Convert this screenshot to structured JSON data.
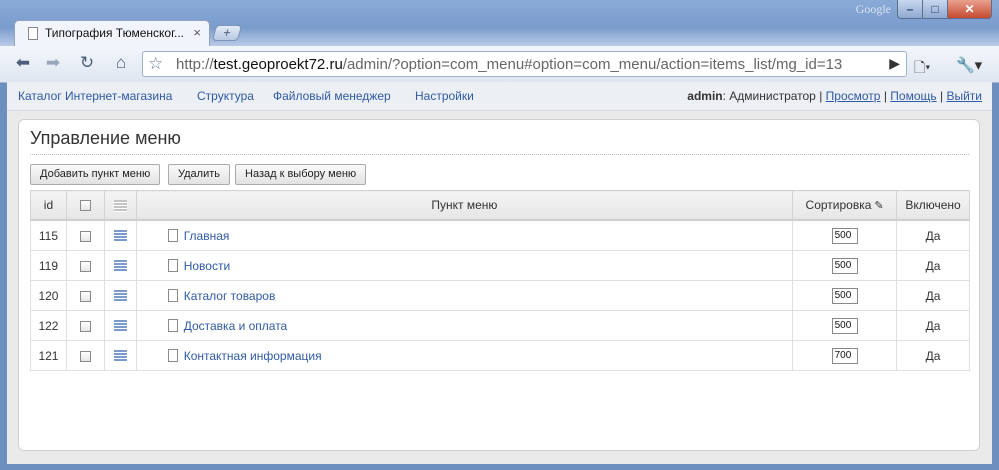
{
  "window": {
    "brand": "Google",
    "tab_title": "Типография Тюменског...",
    "tab_close": "×",
    "newtab": "+"
  },
  "toolbar": {
    "url_scheme": "http://",
    "url_host": "test.geoproekt72.ru",
    "url_path": "/admin/?option=com_menu#option=com_menu/action=items_list/mg_id=13"
  },
  "topnav": {
    "links": [
      "Каталог Интернет-магазина",
      "Структура",
      "Файловый менеджер",
      "Настройки"
    ],
    "user": "admin",
    "role": ": Администратор",
    "preview": "Просмотр",
    "help": "Помощь",
    "logout": "Выйти",
    "sep": "|"
  },
  "panel": {
    "title": "Управление меню",
    "buttons": {
      "add": "Добавить пункт меню",
      "delete": "Удалить",
      "back": "Назад к выбору меню"
    }
  },
  "table": {
    "headers": {
      "id": "id",
      "item": "Пункт меню",
      "sort": "Сортировка",
      "enabled": "Включено"
    },
    "rows": [
      {
        "id": "115",
        "name": "Главная",
        "sort": "500",
        "enabled": "Да"
      },
      {
        "id": "119",
        "name": "Новости",
        "sort": "500",
        "enabled": "Да"
      },
      {
        "id": "120",
        "name": "Каталог товаров",
        "sort": "500",
        "enabled": "Да"
      },
      {
        "id": "122",
        "name": "Доставка и оплата",
        "sort": "500",
        "enabled": "Да"
      },
      {
        "id": "121",
        "name": "Контактная информация",
        "sort": "700",
        "enabled": "Да"
      }
    ]
  }
}
